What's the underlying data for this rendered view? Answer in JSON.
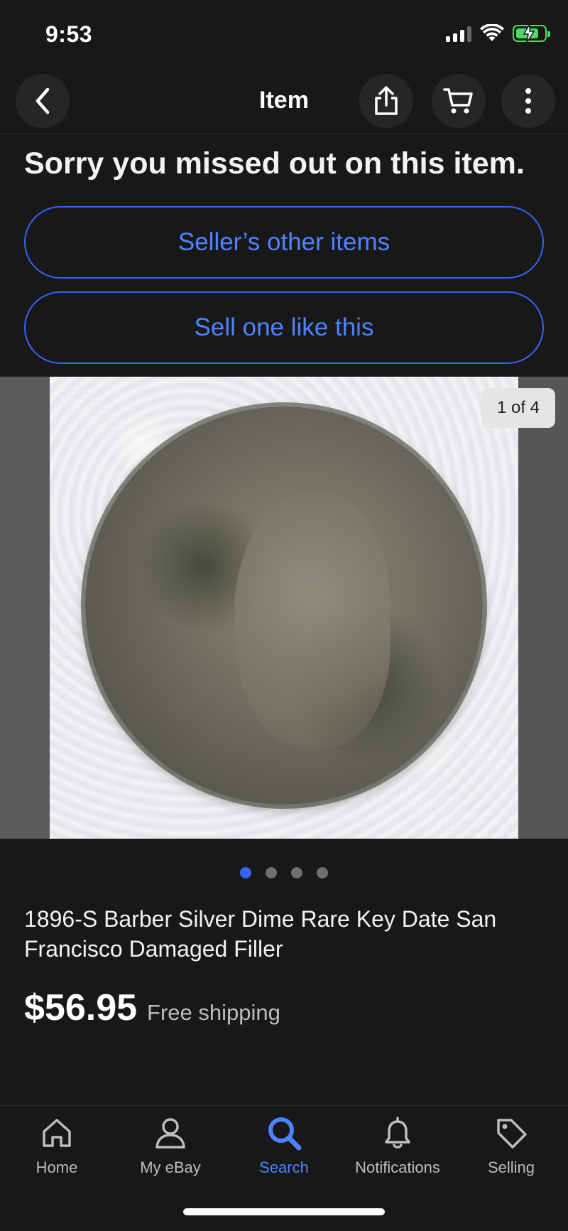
{
  "status_bar": {
    "time": "9:53",
    "icons": [
      "cellular-signal-icon",
      "wifi-icon",
      "battery-charging-icon"
    ],
    "battery_color": "#4cd964"
  },
  "nav": {
    "title": "Item",
    "icons": [
      "chevron-left-icon",
      "share-icon",
      "cart-icon",
      "more-vertical-icon"
    ]
  },
  "notice": {
    "title": "Sorry you missed out on this item."
  },
  "actions": {
    "sellers_other_items": "Seller’s other items",
    "sell_one_like_this": "Sell one like this"
  },
  "gallery": {
    "counter": "1 of 4",
    "total": 4,
    "active_index": 0,
    "accent_color": "#3665f3"
  },
  "item": {
    "title": "1896-S Barber Silver Dime Rare Key Date San Francisco Damaged Filler",
    "price": "$56.95",
    "shipping": "Free shipping"
  },
  "tab_bar": {
    "items": [
      {
        "label": "Home",
        "icon": "home-icon"
      },
      {
        "label": "My eBay",
        "icon": "person-icon"
      },
      {
        "label": "Search",
        "icon": "search-icon",
        "active": true
      },
      {
        "label": "Notifications",
        "icon": "bell-icon"
      },
      {
        "label": "Selling",
        "icon": "tag-icon"
      }
    ],
    "active_color": "#4d83ff"
  }
}
